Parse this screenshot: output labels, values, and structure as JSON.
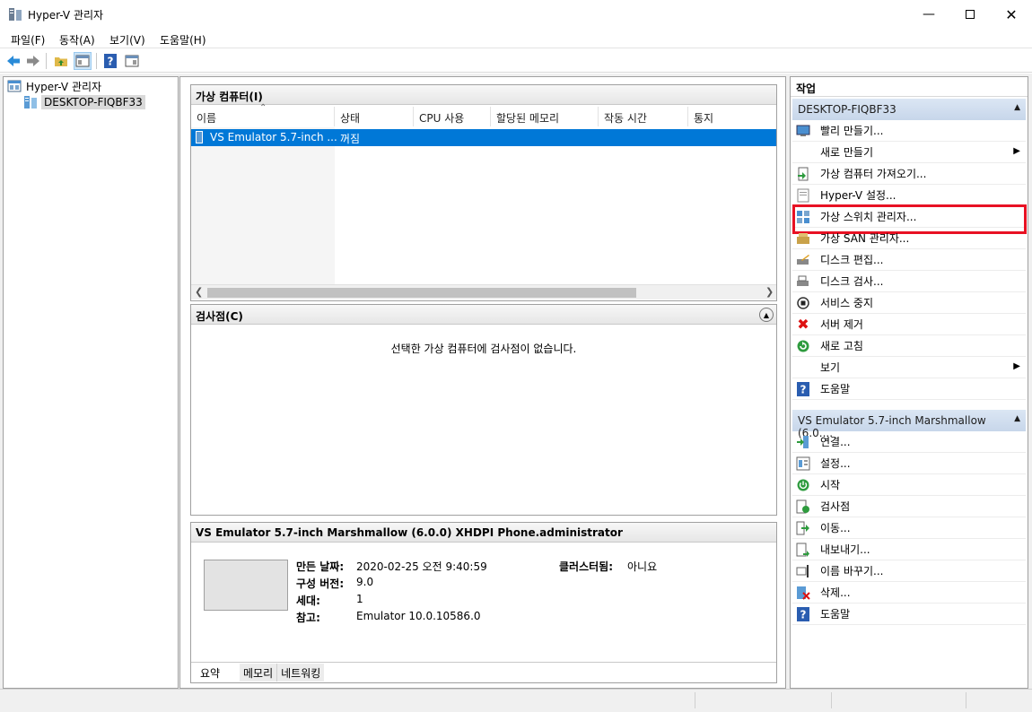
{
  "window": {
    "title": "Hyper-V 관리자"
  },
  "menu": [
    "파일(F)",
    "동작(A)",
    "보기(V)",
    "도움말(H)"
  ],
  "tree": {
    "root": "Hyper-V 관리자",
    "host": "DESKTOP-FIQBF33"
  },
  "vm_section": {
    "title": "가상 컴퓨터(I)",
    "columns": [
      "이름",
      "상태",
      "CPU 사용",
      "할당된 메모리",
      "작동 시간",
      "통지"
    ],
    "rows": [
      {
        "name": "VS Emulator 5.7-inch ...",
        "state": "꺼짐"
      }
    ]
  },
  "checkpoint_section": {
    "title": "검사점(C)",
    "empty_message": "선택한 가상 컴퓨터에 검사점이 없습니다."
  },
  "detail_section": {
    "title": "VS Emulator 5.7-inch Marshmallow (6.0.0) XHDPI Phone.administrator",
    "created_label": "만든 날짜:",
    "created_value": "2020-02-25 오전 9:40:59",
    "config_label": "구성 버전:",
    "config_value": "9.0",
    "gen_label": "세대:",
    "gen_value": "1",
    "note_label": "참고:",
    "note_value": "Emulator 10.0.10586.0",
    "cluster_label": "클러스터됨:",
    "cluster_value": "아니요",
    "tabs": [
      "요약",
      "메모리",
      "네트워킹"
    ]
  },
  "actions": {
    "title": "작업",
    "host_group": "DESKTOP-FIQBF33",
    "host_items": [
      {
        "label": "빨리 만들기...",
        "icon": "quick-create-icon"
      },
      {
        "label": "새로 만들기",
        "icon": "",
        "submenu": true
      },
      {
        "label": "가상 컴퓨터 가져오기...",
        "icon": "import-icon"
      },
      {
        "label": "Hyper-V 설정...",
        "icon": "settings-icon"
      },
      {
        "label": "가상 스위치 관리자...",
        "icon": "switch-manager-icon"
      },
      {
        "label": "가상 SAN 관리자...",
        "icon": "san-manager-icon"
      },
      {
        "label": "디스크 편집...",
        "icon": "disk-edit-icon"
      },
      {
        "label": "디스크 검사...",
        "icon": "disk-inspect-icon"
      },
      {
        "label": "서비스 중지",
        "icon": "stop-service-icon"
      },
      {
        "label": "서버 제거",
        "icon": "remove-server-icon"
      },
      {
        "label": "새로 고침",
        "icon": "refresh-icon"
      },
      {
        "label": "보기",
        "icon": "",
        "submenu": true
      },
      {
        "label": "도움말",
        "icon": "help-icon"
      }
    ],
    "vm_group": "VS Emulator 5.7-inch Marshmallow (6.0....",
    "vm_items": [
      {
        "label": "연결...",
        "icon": "connect-icon"
      },
      {
        "label": "설정...",
        "icon": "vm-settings-icon"
      },
      {
        "label": "시작",
        "icon": "start-icon"
      },
      {
        "label": "검사점",
        "icon": "checkpoint-icon"
      },
      {
        "label": "이동...",
        "icon": "move-icon"
      },
      {
        "label": "내보내기...",
        "icon": "export-icon"
      },
      {
        "label": "이름 바꾸기...",
        "icon": "rename-icon"
      },
      {
        "label": "삭제...",
        "icon": "delete-icon"
      },
      {
        "label": "도움말",
        "icon": "help-icon"
      }
    ]
  },
  "colors": {
    "selection": "#0078d7",
    "highlight_box": "#e81123",
    "group_header": "#c7d6ea"
  }
}
